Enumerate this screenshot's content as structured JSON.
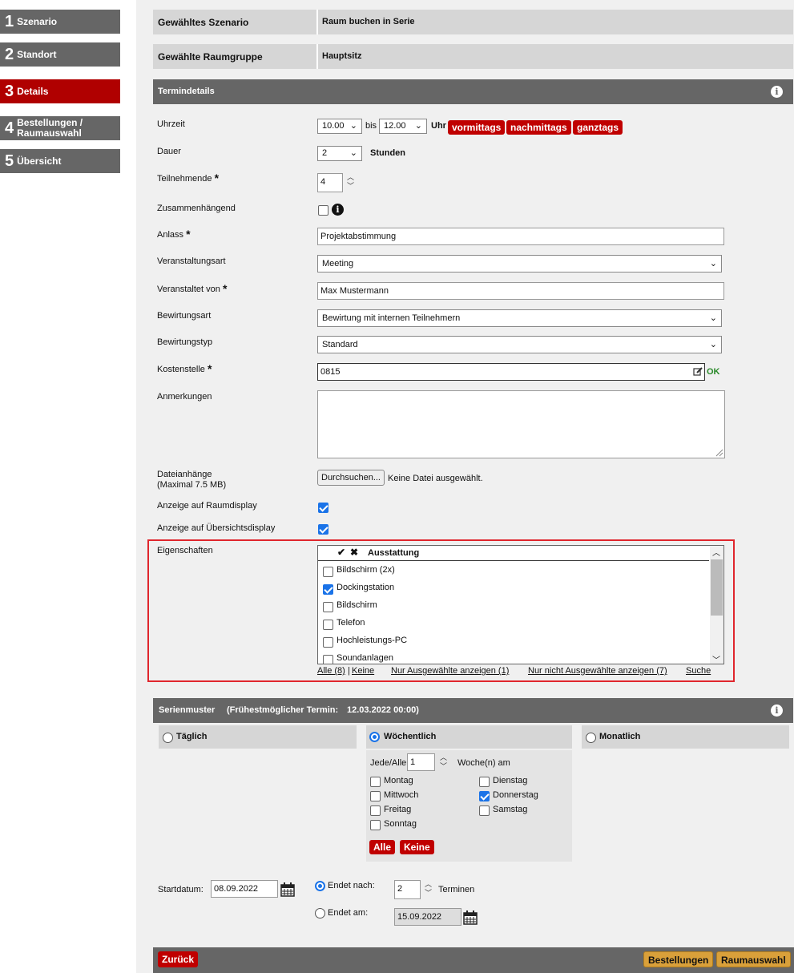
{
  "steps": [
    {
      "num": "1",
      "label": "Szenario"
    },
    {
      "num": "2",
      "label": "Standort"
    },
    {
      "num": "3",
      "label": "Details"
    },
    {
      "num": "4",
      "label": "Bestellungen / Raumauswahl"
    },
    {
      "num": "5",
      "label": "Übersicht"
    }
  ],
  "summary": {
    "scenario_label": "Gewähltes Szenario",
    "scenario_value": "Raum buchen in Serie",
    "group_label": "Gewählte Raumgruppe",
    "group_value": "Hauptsitz"
  },
  "termindetails": {
    "title": "Termindetails"
  },
  "form": {
    "uhrzeit_label": "Uhrzeit",
    "from": "10.00",
    "bis": "bis",
    "to": "12.00",
    "uhr": "Uhr",
    "vormittags": "vormittags",
    "nachmittags": "nachmittags",
    "ganztags": "ganztags",
    "dauer_label": "Dauer",
    "dauer": "2",
    "stunden": "Stunden",
    "teilnehmende_label": "Teilnehmende",
    "teilnehmende": "4",
    "zusammen_label": "Zusammenhängend",
    "anlass_label": "Anlass",
    "anlass": "Projektabstimmung",
    "vart_label": "Veranstaltungsart",
    "vart": "Meeting",
    "vvon_label": "Veranstaltet von",
    "vvon": "Max Mustermann",
    "bart_label": "Bewirtungsart",
    "bart": "Bewirtung mit internen Teilnehmern",
    "btyp_label": "Bewirtungstyp",
    "btyp": "Standard",
    "kst_label": "Kostenstelle",
    "kst": "0815",
    "ok": "OK",
    "anm_label": "Anmerkungen",
    "datei_label": "Dateianhänge",
    "datei_sub": "(Maximal 7.5 MB)",
    "browse": "Durchsuchen...",
    "nofile": "Keine Datei ausgewählt.",
    "raumdisplay_label": "Anzeige auf Raumdisplay",
    "uebersicht_label": "Anzeige auf Übersichtsdisplay",
    "eig_label": "Eigenschaften"
  },
  "eigenschaften": {
    "header": "Ausstattung",
    "items": [
      {
        "label": "Bildschirm (2x)",
        "checked": false
      },
      {
        "label": "Dockingstation",
        "checked": true
      },
      {
        "label": "Bildschirm",
        "checked": false
      },
      {
        "label": "Telefon",
        "checked": false
      },
      {
        "label": "Hochleistungs-PC",
        "checked": false
      },
      {
        "label": "Soundanlagen",
        "checked": false
      }
    ],
    "all": "Alle (8)",
    "sep": "|",
    "none": "Keine",
    "only_sel": "Nur Ausgewählte anzeigen (1)",
    "only_unsel": "Nur nicht Ausgewählte anzeigen (7)",
    "search": "Suche"
  },
  "serie": {
    "title": "Serienmuster",
    "earliest_prefix": "(Frühestmöglicher Termin:",
    "earliest": "12.03.2022 00:00)",
    "daily": "Täglich",
    "weekly": "Wöchentlich",
    "monthly": "Monatlich",
    "every": "Jede/Alle",
    "every_val": "1",
    "weeks_on": "Woche(n) am",
    "days": [
      {
        "label": "Montag",
        "checked": false
      },
      {
        "label": "Dienstag",
        "checked": false
      },
      {
        "label": "Mittwoch",
        "checked": false
      },
      {
        "label": "Donnerstag",
        "checked": true
      },
      {
        "label": "Freitag",
        "checked": false
      },
      {
        "label": "Samstag",
        "checked": false
      },
      {
        "label": "Sonntag",
        "checked": false
      }
    ],
    "all": "Alle",
    "none": "Keine",
    "start_label": "Startdatum:",
    "start": "08.09.2022",
    "ends_after": "Endet nach:",
    "ends_after_val": "2",
    "terminen": "Terminen",
    "ends_on": "Endet am:",
    "ends_on_val": "15.09.2022"
  },
  "footer": {
    "back": "Zurück",
    "orders": "Bestellungen",
    "rooms": "Raumauswahl"
  },
  "colors": {
    "accent_red": "#c00000",
    "orange": "#d9a03a",
    "highlight_border": "#e0262d",
    "checkbox_blue": "#1a73e8"
  }
}
